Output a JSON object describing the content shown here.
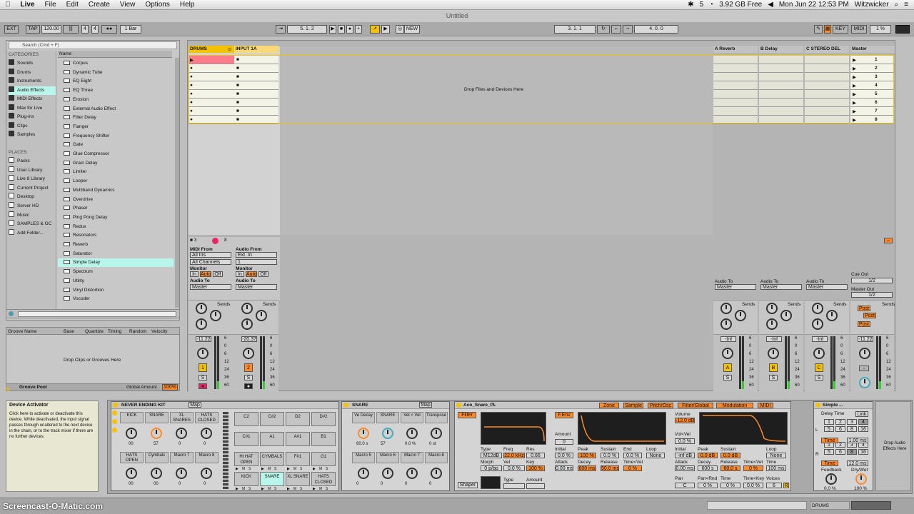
{
  "menubar": {
    "items": [
      "Live",
      "File",
      "Edit",
      "Create",
      "View",
      "Options",
      "Help"
    ],
    "battery": "5",
    "free": "3.92 GB Free",
    "clock": "Mon Jun 22  12:53 PM",
    "user": "Witzwicker"
  },
  "title": "Untitled",
  "control": {
    "ext": "EXT",
    "tap": "TAP",
    "tempo": "120.00",
    "sig_num": "4",
    "sig_den": "4",
    "quant": "1 Bar",
    "pos": "5.   1.   2",
    "new": "NEW",
    "loop_start": "3.   1.   1",
    "loop_len": "4.   0.   0",
    "key": "KEY",
    "midi": "MIDI",
    "cpu": "1 %"
  },
  "browser": {
    "search": "Search (Cmd + F)",
    "categories_title": "CATEGORIES",
    "categories": [
      "Sounds",
      "Drums",
      "Instruments",
      "Audio Effects",
      "MIDI Effects",
      "Max for Live",
      "Plug-ins",
      "Clips",
      "Samples"
    ],
    "places_title": "PLACES",
    "places": [
      "Packs",
      "User Library",
      "Live 8 Library",
      "Current Project",
      "Desktop",
      "Server HD",
      "Music",
      "SAMPLES & GC",
      "Add Folder..."
    ],
    "name_col": "Name",
    "items": [
      "Corpus",
      "Dynamic Tube",
      "EQ Eight",
      "EQ Three",
      "Erosion",
      "External Audio Effect",
      "Filter Delay",
      "Flanger",
      "Frequency Shifter",
      "Gate",
      "Glue Compressor",
      "Grain Delay",
      "Limiter",
      "Looper",
      "Multiband Dynamics",
      "Overdrive",
      "Phaser",
      "Ping Pong Delay",
      "Redux",
      "Resonators",
      "Reverb",
      "Saturator",
      "Simple Delay",
      "Spectrum",
      "Utility",
      "Vinyl Distortion",
      "Vocoder"
    ]
  },
  "groove": {
    "cols": [
      "Groove Name",
      "Base",
      "Quantize",
      "Timing",
      "Random",
      "Velocity"
    ],
    "drop": "Drop Clips or Grooves Here",
    "pool": "Groove Pool",
    "amount_label": "Global Amount",
    "amount": "100%"
  },
  "session": {
    "tracks": [
      "DRUMS",
      "INPUT 1A"
    ],
    "returns": [
      "A Reverb",
      "B Delay",
      "C STEREO DEL"
    ],
    "master": "Master",
    "drop": "Drop Files and Devices Here",
    "scenes": [
      "1",
      "2",
      "3",
      "4",
      "5",
      "6",
      "7",
      "8"
    ]
  },
  "io": {
    "midi_from": "MIDI From",
    "audio_from": "Audio From",
    "all_ins": "All Ins",
    "ext_in": "Ext. In",
    "all_channels": "All Channels",
    "ch1": "1",
    "monitor": "Monitor",
    "in": "In",
    "auto": "Auto",
    "off": "Off",
    "audio_to": "Audio To",
    "master": "Master",
    "sends": "Sends",
    "cue_out": "Cue Out",
    "master_out": "Master Out",
    "half": "1/2",
    "post": "Post"
  },
  "mixer": {
    "vol1": "-11.22",
    "vol2": "-20.37",
    "vol_inf": "-Inf",
    "vol_master": "-11.22",
    "num1": "1",
    "num2": "2",
    "a": "A",
    "b": "B",
    "c": "C",
    "s": "S",
    "scale": [
      "6",
      "0",
      "6",
      "12",
      "24",
      "36",
      "60"
    ]
  },
  "info": {
    "title": "Device Activator",
    "text": "Click here to activate or deactivate this device. While deactivated, the input signal passes through unaltered to the next device in the chain, or to the track mixer if there are no further devices."
  },
  "kit": {
    "title": "NEVER ENDING KIT",
    "map": "Map",
    "macros": [
      "KICK",
      "SNARE",
      "XL SNARES",
      "HATS CLOSED",
      "HATS OPEN",
      "Cymbals",
      "Macro 7",
      "Macro 8"
    ],
    "mvals": [
      "00",
      "57",
      "0",
      "0",
      "00",
      "00",
      "0",
      "0"
    ],
    "pads": [
      "C2",
      "C#2",
      "D2",
      "D#2",
      "C#1",
      "A1",
      "A#1",
      "B1",
      "HI HAT OPEN",
      "CYMBALS",
      "F#1",
      "G1",
      "KICK",
      "SNARE",
      "XL SNARE",
      "HATS CLOSED"
    ],
    "m": "M",
    "s": "S"
  },
  "snare": {
    "title": "SNARE",
    "map": "Map",
    "macros": [
      "Ve Decay",
      "SNARE",
      "Vel < Vel",
      "Transpose",
      "Macro 5",
      "Macro 6",
      "Macro 7",
      "Macro 8"
    ],
    "vals": [
      "60.0 s",
      "57",
      "0.0 %",
      "0 st",
      "0",
      "0",
      "0",
      "0"
    ]
  },
  "simpler": {
    "title": "Aco_Snare_PL",
    "tabs": [
      "Zone",
      "Sample",
      "Pitch/Osc",
      "Filter/Global",
      "Modulation",
      "MIDI"
    ],
    "filter": "Filter",
    "fenv": "F.Env",
    "type": "Type",
    "freq": "Freq",
    "res": "Res",
    "type_v": "M12dB",
    "freq_v": "22.0 kHz",
    "res_v": "0.66",
    "morph": "Morph",
    "vel": "Vel",
    "key": "Key",
    "morph_v": "0 p/bp",
    "vel_v": "0.0 %",
    "key_v": "100 %",
    "amount": "Amount",
    "amount_v": "0",
    "initial": "Initial",
    "peak": "Peak",
    "sustain": "Sustain",
    "end": "End",
    "loop": "Loop",
    "init_v": "0.0 %",
    "peak_v": "100 %",
    "sus_v": "0.0 %",
    "end_v": "0.0 %",
    "loop_v": "None",
    "attack": "Attack",
    "decay": "Decay",
    "release": "Release",
    "timevel": "Time<Vel",
    "att_v": "0.00 ms",
    "dec_v": "600 ms",
    "rel_v": "50.0 ms",
    "tv_v": "0 %",
    "shaper": "Shaper",
    "volume": "Volume",
    "vol_v": "-12.0 dB",
    "volvel": "Vol<Vel",
    "volvel_v": "0.0 %",
    "ainit_v": "-inf dB",
    "apeak_v": "0.0 dB",
    "asus_v": "0.0 dB",
    "aloop_v": "None",
    "aatt_v": "0.00 ms",
    "adec_v": "600 s",
    "arel_v": "60.0 s",
    "atv_v": "0 %",
    "atime": "Time",
    "atime_v": "100 ms",
    "pan": "Pan",
    "panrnd": "Pan<Rnd",
    "tkv": "Time<Key",
    "voices": "Voices",
    "pan_v": "C",
    "panrnd_v": "0 %",
    "time2_v": "0 %",
    "tkv_v": "0.0 %",
    "voices_v": "6"
  },
  "delay": {
    "title": "Simple ...",
    "time": "Delay Time",
    "link": "Link",
    "l": "L",
    "r": "R",
    "nums": [
      "1",
      "2",
      "3",
      "4",
      "5",
      "6",
      "8",
      "16"
    ],
    "timebtn": "Time",
    "l_ms": "1.00 ms",
    "r_ms": "12.0 ms",
    "feedback": "Feedback",
    "drywet": "Dry/Wet",
    "fb_v": "0.0 %",
    "dw_v": "100 %"
  },
  "drop_fx": "Drop Audio Effects Here",
  "footer": {
    "watermark": "Screencast-O-Matic.com",
    "drums": "DRUMS"
  }
}
